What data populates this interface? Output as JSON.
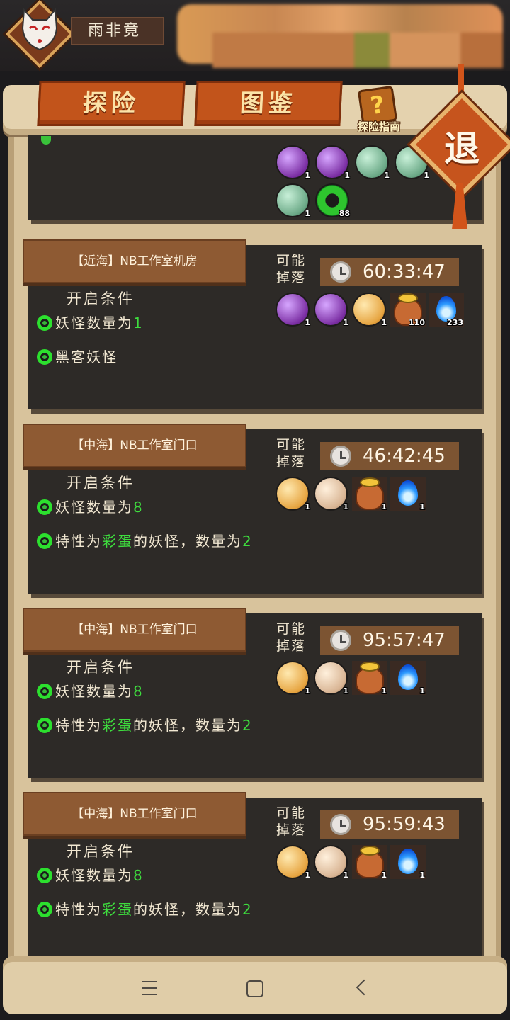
{
  "player": {
    "name": "雨非竟"
  },
  "tabs": [
    {
      "label": "探险"
    },
    {
      "label": "图鉴"
    }
  ],
  "guide": {
    "label": "探险指南",
    "icon_mark": "?"
  },
  "exit": {
    "label": "退"
  },
  "partial_card": {
    "items": [
      {
        "icon": "purple-orb-icon",
        "qty": "1",
        "style": "orb-purple"
      },
      {
        "icon": "purple-orb-icon",
        "qty": "1",
        "style": "orb-purple"
      },
      {
        "icon": "green-orb-icon",
        "qty": "1",
        "style": "orb-green"
      },
      {
        "icon": "green-orb-icon",
        "qty": "1",
        "style": "orb-green"
      },
      {
        "icon": "green-orb-icon",
        "qty": "1",
        "style": "orb-green"
      },
      {
        "icon": "green-ring-icon",
        "qty": "88",
        "style": "ring-green"
      }
    ]
  },
  "cards": [
    {
      "title": "【近海】NB工作室机房",
      "drop_label": "可能掉落",
      "timer": "60:33:47",
      "cond_head": "开启条件",
      "conditions": [
        {
          "prefix": "妖怪数量为",
          "highlight": "1",
          "suffix": ""
        },
        {
          "prefix": "黑客妖怪",
          "highlight": "",
          "suffix": ""
        }
      ],
      "items": [
        {
          "icon": "purple-orb-icon",
          "qty": "1",
          "kind": "orb-purple"
        },
        {
          "icon": "purple-mask-orb-icon",
          "qty": "1",
          "kind": "orb-purple"
        },
        {
          "icon": "gold-beetle-orb-icon",
          "qty": "1",
          "kind": "orb-gold"
        },
        {
          "icon": "coin-pot-icon",
          "qty": "110",
          "kind": "pot"
        },
        {
          "icon": "blue-flame-icon",
          "qty": "233",
          "kind": "flame"
        }
      ]
    },
    {
      "title": "【中海】NB工作室门口",
      "drop_label": "可能掉落",
      "timer": "46:42:45",
      "cond_head": "开启条件",
      "conditions": [
        {
          "prefix": "妖怪数量为",
          "highlight": "8",
          "suffix": ""
        },
        {
          "prefix": "特性为",
          "highlight": "彩蛋",
          "suffix": "的妖怪，数量为",
          "highlight2": "2"
        }
      ],
      "items": [
        {
          "icon": "gold-beetle-orb-icon",
          "qty": "1",
          "kind": "orb-gold"
        },
        {
          "icon": "beige-egg-orb-icon",
          "qty": "1",
          "kind": "orb-beige"
        },
        {
          "icon": "coin-pot-icon",
          "qty": "1",
          "kind": "pot"
        },
        {
          "icon": "blue-flame-icon",
          "qty": "1",
          "kind": "flame"
        }
      ]
    },
    {
      "title": "【中海】NB工作室门口",
      "drop_label": "可能掉落",
      "timer": "95:57:47",
      "cond_head": "开启条件",
      "conditions": [
        {
          "prefix": "妖怪数量为",
          "highlight": "8",
          "suffix": ""
        },
        {
          "prefix": "特性为",
          "highlight": "彩蛋",
          "suffix": "的妖怪，数量为",
          "highlight2": "2"
        }
      ],
      "items": [
        {
          "icon": "gold-beetle-orb-icon",
          "qty": "1",
          "kind": "orb-gold"
        },
        {
          "icon": "beige-egg-orb-icon",
          "qty": "1",
          "kind": "orb-beige"
        },
        {
          "icon": "coin-pot-icon",
          "qty": "1",
          "kind": "pot"
        },
        {
          "icon": "blue-flame-icon",
          "qty": "1",
          "kind": "flame"
        }
      ]
    },
    {
      "title": "【中海】NB工作室门口",
      "drop_label": "可能掉落",
      "timer": "95:59:43",
      "cond_head": "开启条件",
      "conditions": [
        {
          "prefix": "妖怪数量为",
          "highlight": "8",
          "suffix": ""
        },
        {
          "prefix": "特性为",
          "highlight": "彩蛋",
          "suffix": "的妖怪，数量为",
          "highlight2": "2"
        }
      ],
      "items": [
        {
          "icon": "gold-beetle-orb-icon",
          "qty": "1",
          "kind": "orb-gold"
        },
        {
          "icon": "beige-egg-orb-icon",
          "qty": "1",
          "kind": "orb-beige"
        },
        {
          "icon": "coin-pot-icon",
          "qty": "1",
          "kind": "pot"
        },
        {
          "icon": "blue-flame-icon",
          "qty": "1",
          "kind": "flame"
        }
      ]
    }
  ],
  "colors": {
    "tab_orange": "#c2541b",
    "card_bg": "#2d2a27",
    "highlight_green": "#3edc3e",
    "scroll_parchment": "#d8c39c"
  },
  "nav": [
    {
      "icon": "menu-icon"
    },
    {
      "icon": "home-icon"
    },
    {
      "icon": "back-icon"
    }
  ]
}
